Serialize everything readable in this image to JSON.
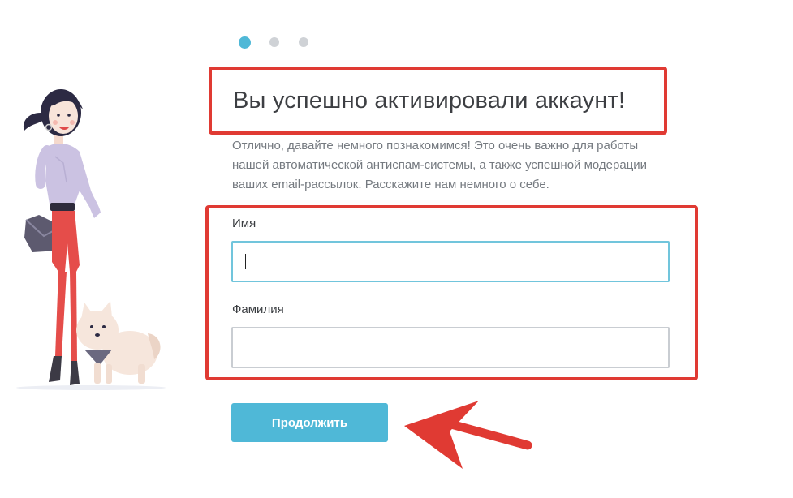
{
  "onboarding": {
    "steps": [
      {
        "active": true
      },
      {
        "active": false
      },
      {
        "active": false
      }
    ],
    "title": "Вы успешно активировали аккаунт!",
    "description": "Отлично, давайте немного познакомимся! Это очень важно для работы нашей автоматической антиспам-системы, а также успешной модерации ваших email-рассылок. Расскажите нам немного о себе.",
    "form": {
      "first_name_label": "Имя",
      "first_name_value": "",
      "last_name_label": "Фамилия",
      "last_name_value": ""
    },
    "continue_label": "Продолжить"
  },
  "colors": {
    "accent": "#4fb8d7",
    "annotation": "#e03a33",
    "inactive_dot": "#cfd2d6"
  }
}
